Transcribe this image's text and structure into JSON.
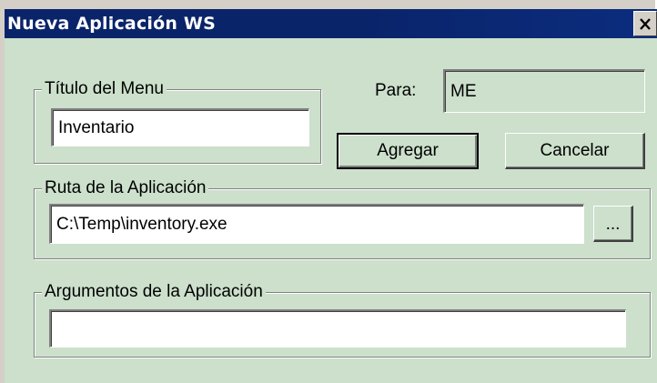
{
  "window": {
    "title": "Nueva Aplicación WS",
    "close_glyph": "×"
  },
  "menu_title_group": {
    "legend": "Título del Menu",
    "value": "Inventario"
  },
  "para": {
    "label": "Para:",
    "value": "ME"
  },
  "buttons": {
    "add": "Agregar",
    "cancel": "Cancelar",
    "browse": "..."
  },
  "app_path_group": {
    "legend": "Ruta de la Aplicación",
    "value": "C:\\Temp\\inventory.exe"
  },
  "app_args_group": {
    "legend": "Argumentos de la Aplicación",
    "value": ""
  },
  "colors": {
    "titlebar": "#0a246a",
    "client_background": "#cce0cc"
  }
}
